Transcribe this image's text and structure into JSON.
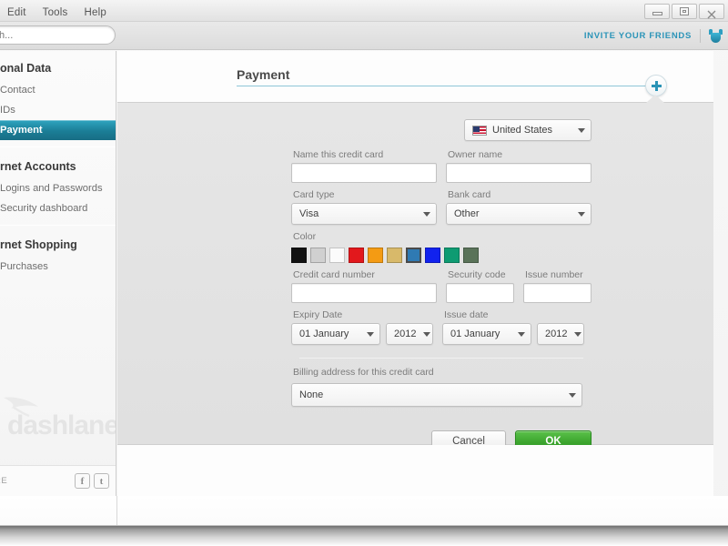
{
  "window": {
    "menu": [
      "Edit",
      "Tools",
      "Help"
    ],
    "controls": [
      {
        "name": "minimize",
        "glyph": "minimize-icon"
      },
      {
        "name": "maximize",
        "glyph": "maximize-icon"
      },
      {
        "name": "close",
        "glyph": "close-icon"
      }
    ]
  },
  "toolbar": {
    "search_value": "",
    "search_placeholder": "h...",
    "invite_label": "INVITE YOUR FRIENDS",
    "bug_icon": "dashlane-bug-icon"
  },
  "sidebar": {
    "groups": [
      {
        "heading": "onal Data",
        "items": [
          {
            "label": "Contact",
            "active": false
          },
          {
            "label": "IDs",
            "active": false
          },
          {
            "label": "Payment",
            "active": true
          }
        ]
      },
      {
        "heading": "rnet Accounts",
        "items": [
          {
            "label": "Logins and Passwords",
            "active": false
          },
          {
            "label": "Security dashboard",
            "active": false
          }
        ]
      },
      {
        "heading": "rnet Shopping",
        "items": [
          {
            "label": "Purchases",
            "active": false
          }
        ]
      }
    ],
    "logo_text": "dashlane",
    "share_label": "RE",
    "social": [
      {
        "name": "facebook-icon",
        "glyph": "f"
      },
      {
        "name": "twitter-icon",
        "glyph": "t"
      }
    ]
  },
  "content": {
    "page_title": "Payment",
    "add_button_label": "+"
  },
  "form": {
    "country": {
      "label": "",
      "value": "United States",
      "flag": "us-flag-icon"
    },
    "name_card": {
      "label": "Name this credit card",
      "value": "",
      "placeholder": ""
    },
    "owner_name": {
      "label": "Owner name",
      "value": "",
      "placeholder": ""
    },
    "card_type": {
      "label": "Card type",
      "value": "Visa"
    },
    "bank_card": {
      "label": "Bank card",
      "value": "Other"
    },
    "color": {
      "label": "Color",
      "swatches": [
        {
          "hex": "#111111",
          "selected": false
        },
        {
          "hex": "#d0d0d0",
          "selected": false
        },
        {
          "hex": "#fbfbfb",
          "selected": false
        },
        {
          "hex": "#e2181c",
          "selected": false
        },
        {
          "hex": "#f49b13",
          "selected": false
        },
        {
          "hex": "#d8b96a",
          "selected": false
        },
        {
          "hex": "#2f7ab3",
          "selected": true
        },
        {
          "hex": "#1122ee",
          "selected": false
        },
        {
          "hex": "#0e9b72",
          "selected": false
        },
        {
          "hex": "#5a7359",
          "selected": false
        }
      ]
    },
    "credit_card_number": {
      "label": "Credit card number",
      "value": "",
      "placeholder": ""
    },
    "security_code": {
      "label": "Security code",
      "value": "",
      "placeholder": ""
    },
    "issue_number": {
      "label": "Issue number",
      "value": "",
      "placeholder": ""
    },
    "expiry_date": {
      "label": "Expiry Date",
      "month": "01 January",
      "year": "2012"
    },
    "issue_date": {
      "label": "Issue date",
      "month": "01 January",
      "year": "2012"
    },
    "billing_address": {
      "label": "Billing address for this credit card",
      "value": "None"
    },
    "buttons": {
      "cancel": "Cancel",
      "ok": "OK"
    }
  },
  "colors": {
    "accent_teal": "#2a93b6",
    "sidebar_active": "#1b7e97",
    "ok_green": "#3da62f",
    "rule": "#8ec6d8"
  }
}
